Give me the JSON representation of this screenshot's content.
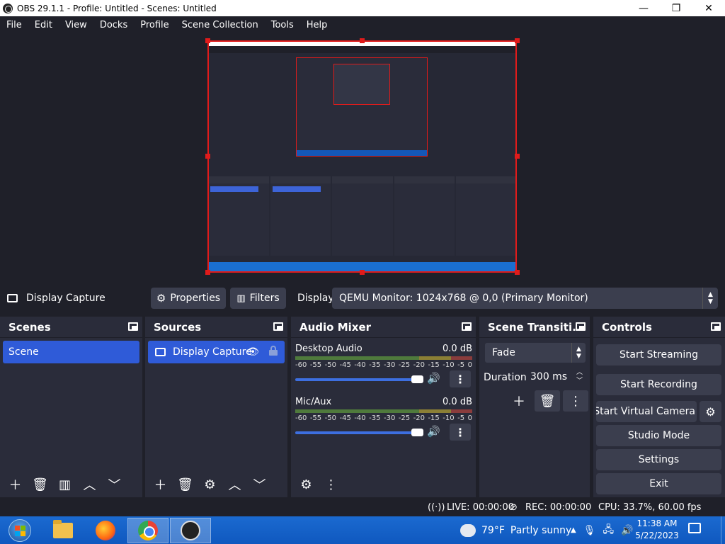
{
  "window": {
    "title": "OBS 29.1.1 - Profile: Untitled - Scenes: Untitled",
    "minimize": "—",
    "maximize": "❐",
    "close": "✕"
  },
  "menu": [
    "File",
    "Edit",
    "View",
    "Docks",
    "Profile",
    "Scene Collection",
    "Tools",
    "Help"
  ],
  "source_toolbar": {
    "source_name": "Display Capture",
    "properties_label": "Properties",
    "filters_label": "Filters",
    "display_label": "Display",
    "display_value": "QEMU Monitor: 1024x768 @ 0,0 (Primary Monitor)"
  },
  "scenes": {
    "title": "Scenes",
    "items": [
      "Scene"
    ]
  },
  "sources": {
    "title": "Sources",
    "items": [
      "Display Capture"
    ]
  },
  "audio_mixer": {
    "title": "Audio Mixer",
    "channels": [
      {
        "name": "Desktop Audio",
        "level": "0.0 dB",
        "volume": 1.0
      },
      {
        "name": "Mic/Aux",
        "level": "0.0 dB",
        "volume": 1.0
      }
    ],
    "ticks": [
      "-60",
      "-55",
      "-50",
      "-45",
      "-40",
      "-35",
      "-30",
      "-25",
      "-20",
      "-15",
      "-10",
      "-5",
      "0"
    ]
  },
  "transitions": {
    "title": "Scene Transiti...",
    "selected": "Fade",
    "duration_label": "Duration",
    "duration_value": "300 ms"
  },
  "controls": {
    "title": "Controls",
    "start_streaming": "Start Streaming",
    "start_recording": "Start Recording",
    "start_virtual_camera": "Start Virtual Camera",
    "studio_mode": "Studio Mode",
    "settings": "Settings",
    "exit": "Exit"
  },
  "status": {
    "live": "LIVE: 00:00:00",
    "rec": "REC: 00:00:00",
    "cpu": "CPU: 33.7%, 60.00 fps"
  },
  "taskbar": {
    "weather_temp": "79°F",
    "weather_desc": "Partly sunny",
    "time": "11:38 AM",
    "date": "5/22/2023"
  },
  "colors": {
    "accent": "#2f5bd8",
    "selection": "#e01b1b",
    "background": "#1f2029",
    "panel": "#2a2c3a"
  }
}
